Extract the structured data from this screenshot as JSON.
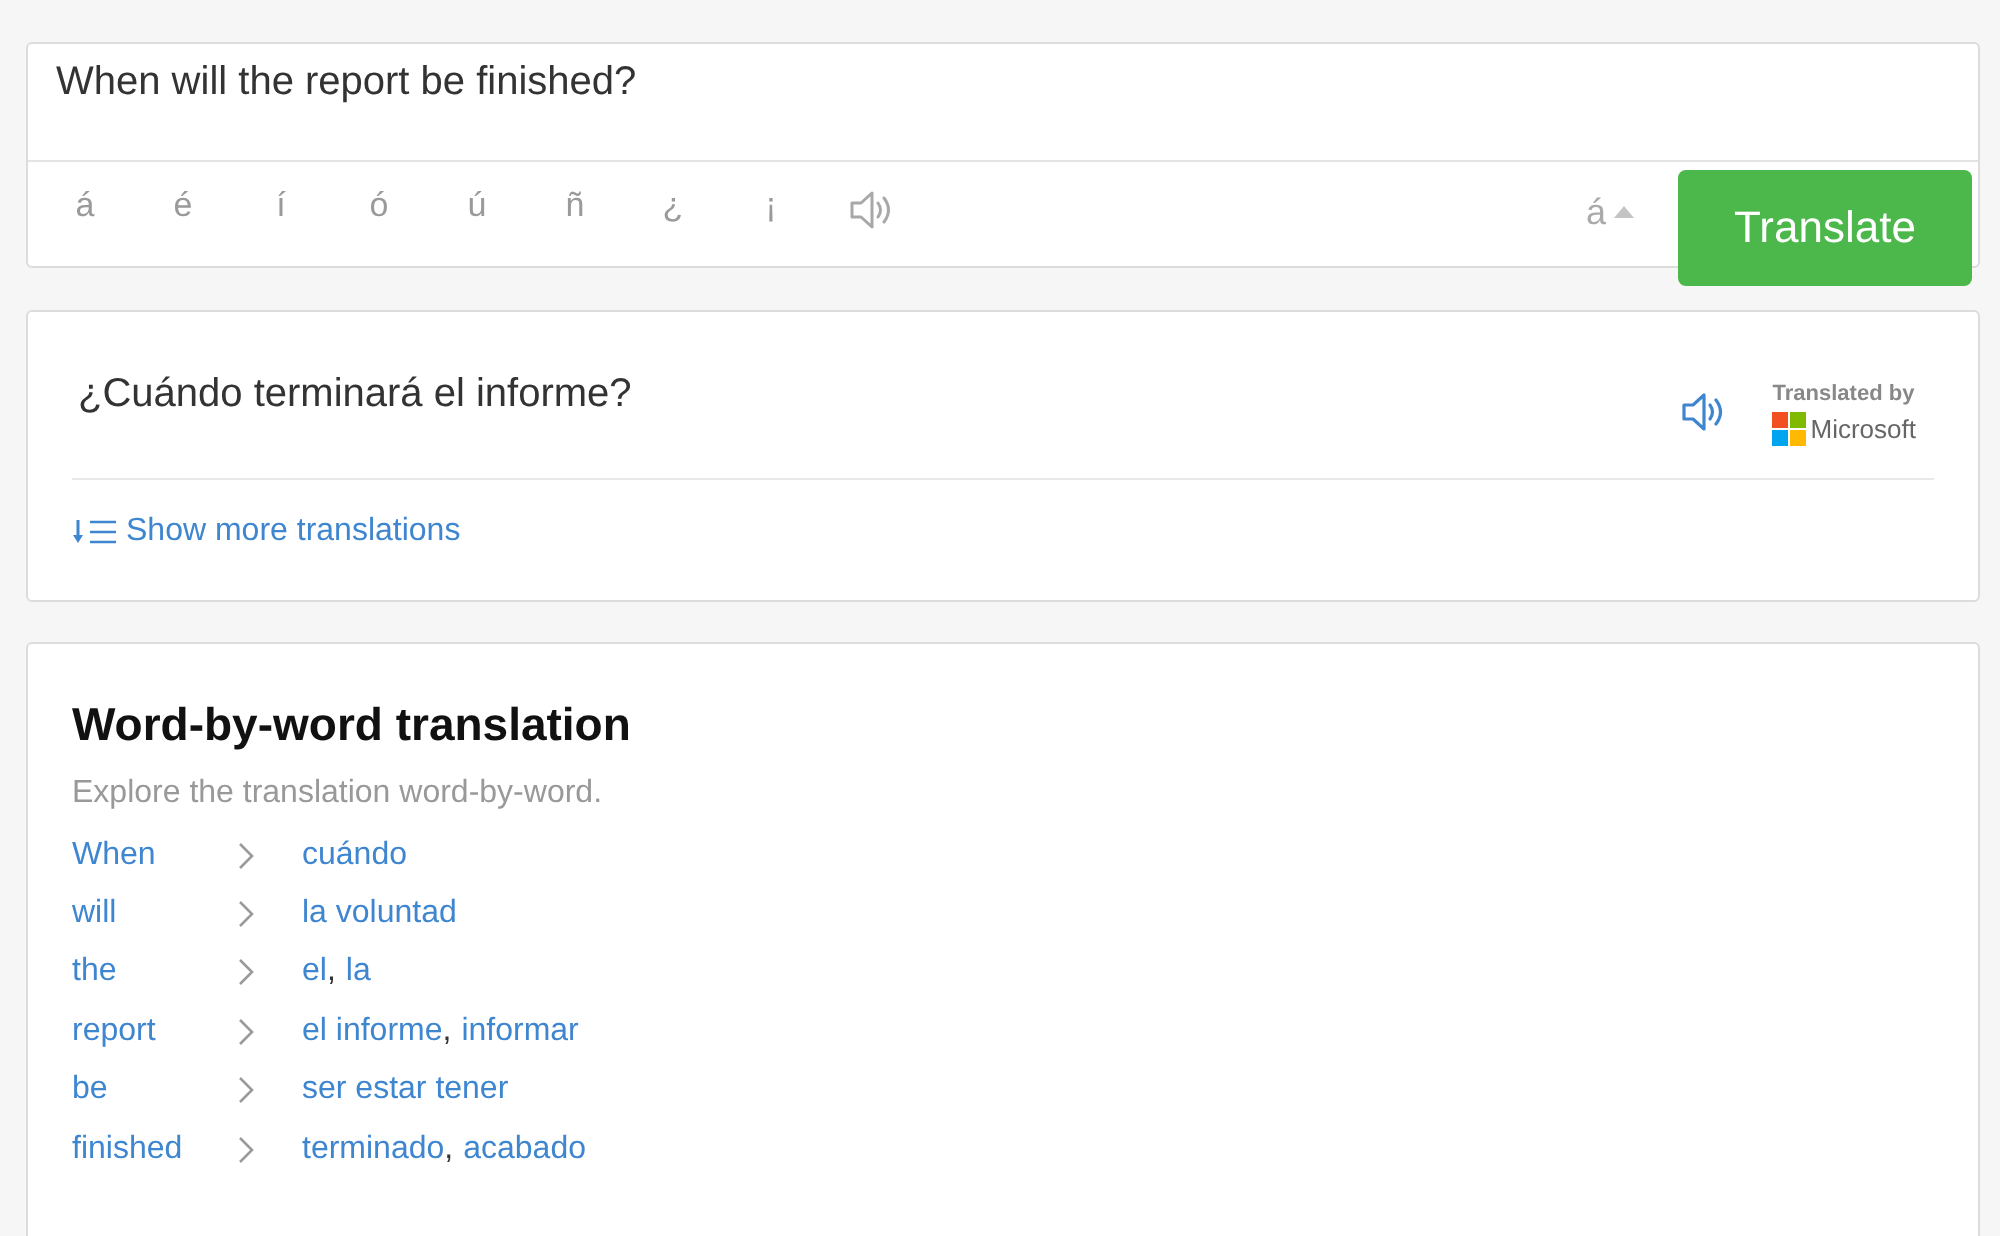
{
  "source": {
    "value": "When will the report be finished?"
  },
  "accent_keys": [
    "á",
    "é",
    "í",
    "ó",
    "ú",
    "ñ",
    "¿",
    "¡"
  ],
  "keyboard_toggle": {
    "label": "á"
  },
  "translate_button": {
    "label": "Translate"
  },
  "result": {
    "text": "¿Cuándo terminará el informe?",
    "attribution": {
      "label": "Translated by",
      "brand": "Microsoft"
    },
    "more_link": "Show more translations"
  },
  "word_by_word": {
    "title": "Word-by-word translation",
    "subtitle": "Explore the translation word-by-word.",
    "rows": [
      {
        "word": "When",
        "parts": [
          {
            "kind": "link",
            "text": "cuándo"
          }
        ]
      },
      {
        "word": "will",
        "parts": [
          {
            "kind": "link",
            "text": "la voluntad"
          }
        ]
      },
      {
        "word": "the",
        "parts": [
          {
            "kind": "link",
            "text": "el"
          },
          {
            "kind": "plain",
            "text": ","
          },
          {
            "kind": "link",
            "text": "la"
          }
        ]
      },
      {
        "word": "report",
        "parts": [
          {
            "kind": "link",
            "text": "el informe"
          },
          {
            "kind": "plain",
            "text": ","
          },
          {
            "kind": "link",
            "text": "informar"
          }
        ]
      },
      {
        "word": "be",
        "parts": [
          {
            "kind": "link",
            "text": "ser estar tener"
          }
        ]
      },
      {
        "word": "finished",
        "parts": [
          {
            "kind": "link",
            "text": "terminado"
          },
          {
            "kind": "plain",
            "text": ","
          },
          {
            "kind": "link",
            "text": "acabado"
          }
        ]
      }
    ]
  }
}
